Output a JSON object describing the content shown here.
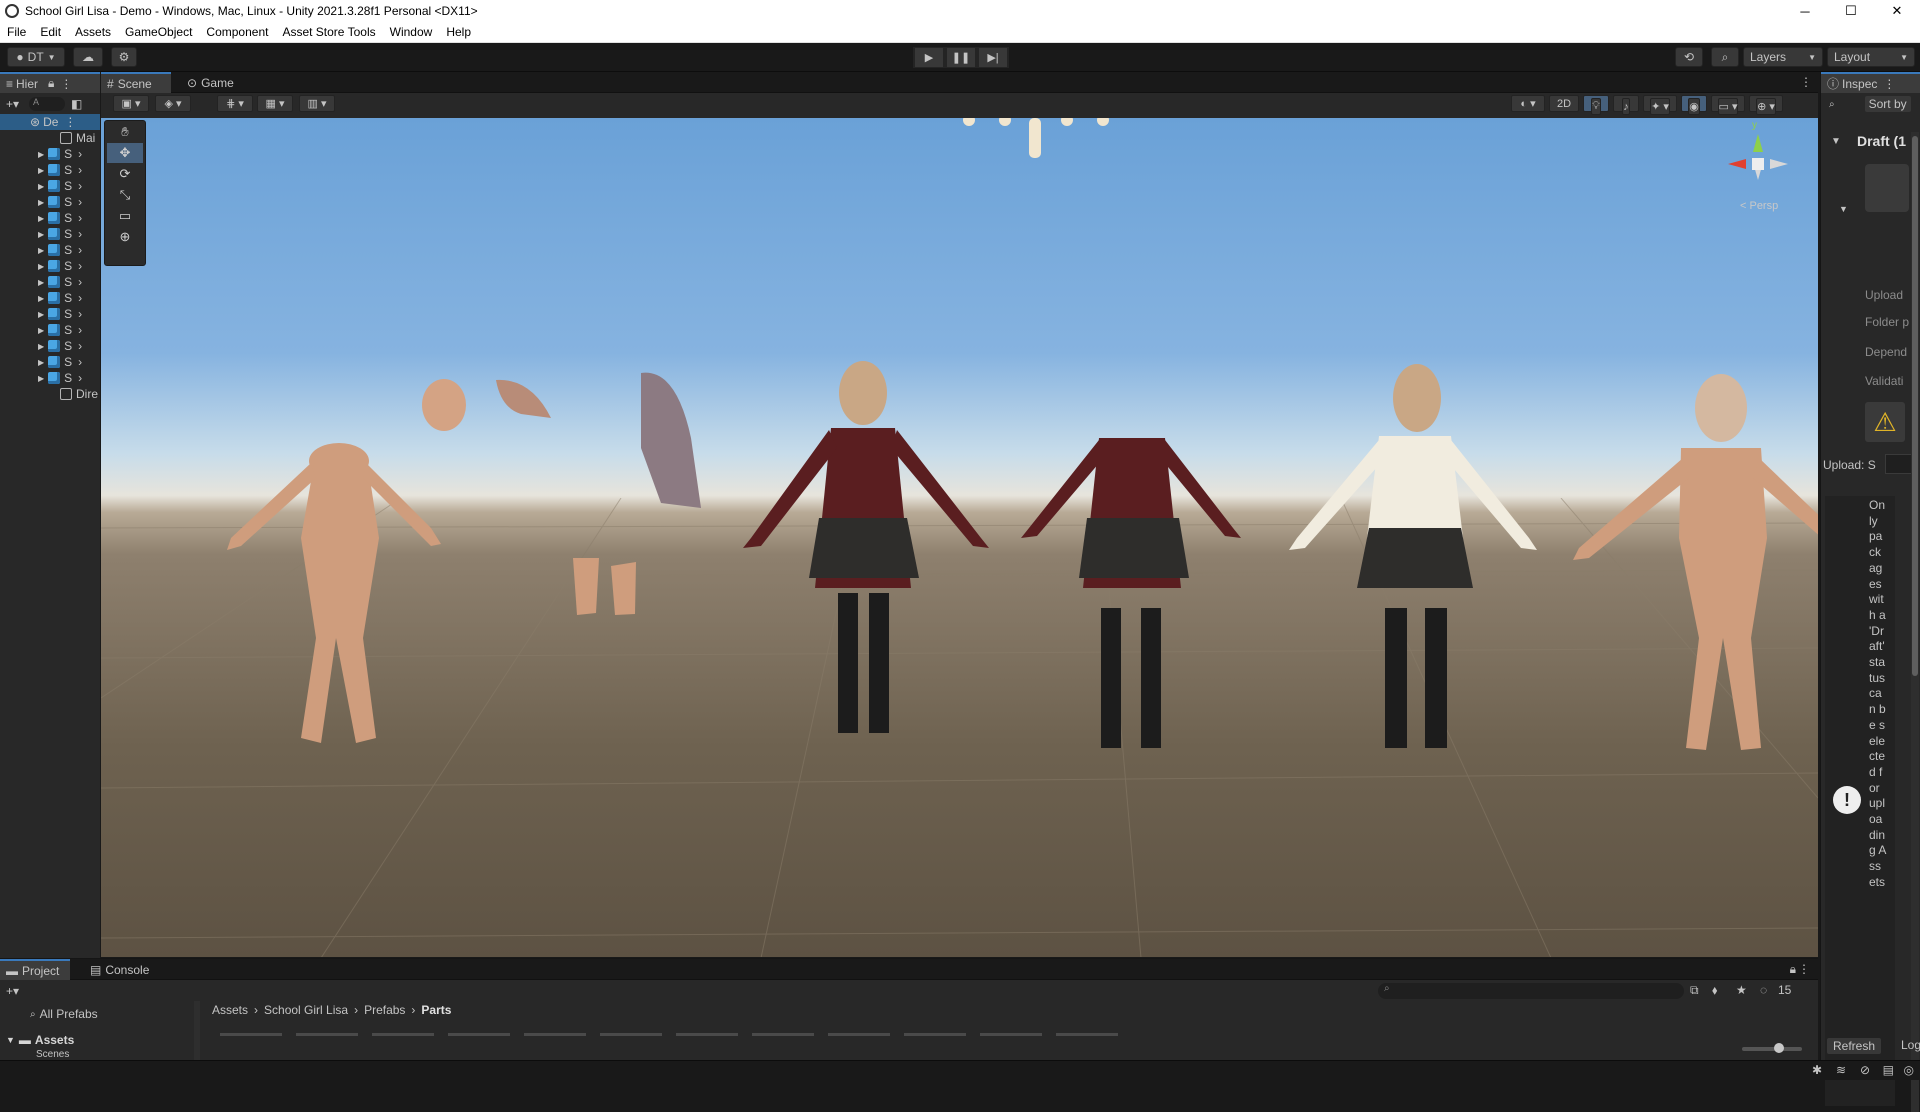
{
  "window": {
    "title": "School Girl Lisa - Demo - Windows, Mac, Linux - Unity 2021.3.28f1 Personal <DX11>",
    "minimize": "─",
    "maximize": "☐",
    "close": "✕"
  },
  "menu": [
    "File",
    "Edit",
    "Assets",
    "GameObject",
    "Component",
    "Asset Store Tools",
    "Window",
    "Help"
  ],
  "toolbar": {
    "account_label": "DT",
    "layers_label": "Layers",
    "layout_label": "Layout"
  },
  "hierarchy": {
    "tab_label": "Hier",
    "search_placeholder": "A",
    "root_label": "De",
    "camera_label": "Mai",
    "item_label": "S",
    "light_label": "Dire",
    "item_count": 15
  },
  "scene": {
    "tabs": [
      "Scene",
      "Game"
    ],
    "mode_2d": "2D",
    "persp_label": "< Persp",
    "gizmo_y": "y"
  },
  "inspector": {
    "tab_label": "Inspec",
    "sort_label": "Sort by",
    "draft_label": "Draft (1",
    "upload_label": "Upload",
    "folder_label": "Folder p",
    "depend_label": "Depend",
    "validation_label": "Validati",
    "upload_status_label": "Upload: S",
    "message": "Only packages with a 'Draft' status can be selected for uploading Assets",
    "refresh_label": "Refresh",
    "logout_label": "Log"
  },
  "project": {
    "tabs": [
      "Project",
      "Console"
    ],
    "favorites_label": "All Prefabs",
    "assets_root": "Assets",
    "assets_child": "Scenes",
    "breadcrumb": [
      "Assets",
      "School Girl Lisa",
      "Prefabs",
      "Parts"
    ],
    "hidden_count": "15"
  },
  "colors": {
    "accent": "#3a79bb",
    "panel": "#282828",
    "dark": "#191919",
    "sky_top": "#6aa1d7",
    "ground": "#6e6250"
  }
}
